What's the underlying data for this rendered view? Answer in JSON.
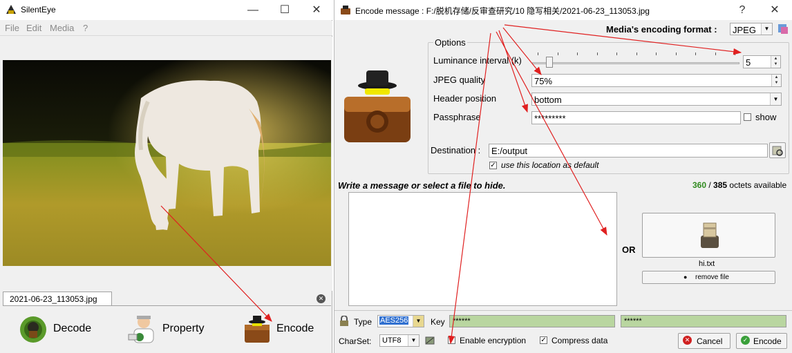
{
  "left_window": {
    "title": "SilentEye",
    "controls": {
      "minimize": "—",
      "maximize": "☐",
      "close": "✕"
    },
    "menu": [
      "File",
      "Edit",
      "Media",
      "?"
    ],
    "file_tab": "2021-06-23_113053.jpg",
    "buttons": {
      "decode": "Decode",
      "property": "Property",
      "encode": "Encode"
    }
  },
  "encode_window": {
    "title": "Encode message : F:/脱机存储/反审查研究/10 隐写相关/2021-06-23_113053.jpg",
    "controls": {
      "help": "?",
      "close": "✕"
    },
    "format_label": "Media's encoding format :",
    "format_value": "JPEG",
    "options_label": "Options",
    "luminance_label": "Luminance interval (k)",
    "luminance_value": "5",
    "jpeg_quality_label": "JPEG quality",
    "jpeg_quality_value": "75%",
    "header_position_label": "Header position",
    "header_position_value": "bottom",
    "passphrase_label": "Passphrase",
    "passphrase_value": "*********",
    "show_label": "show",
    "destination_label": "Destination :",
    "destination_value": "E:/output",
    "use_default_label": "use this location as default",
    "message_prompt": "Write a message or select a file to hide.",
    "octets_used": "360",
    "octets_separator": " / ",
    "octets_total": "385",
    "octets_suffix": " octets available",
    "or_label": "OR",
    "file_name": "hi.txt",
    "remove_file_label": "remove file",
    "type_label": "Type",
    "type_value": "AES256",
    "key_label": "Key",
    "key_value": "******",
    "key_confirm_value": "******",
    "charset_label": "CharSet:",
    "charset_value": "UTF8",
    "enable_encryption_label": "Enable encryption",
    "compress_label": "Compress data",
    "cancel_label": "Cancel",
    "encode_label": "Encode"
  },
  "colors": {
    "annotation_arrow": "#e02020",
    "octets_green": "#2f8a1e",
    "key_field": "#b9d6a0"
  }
}
